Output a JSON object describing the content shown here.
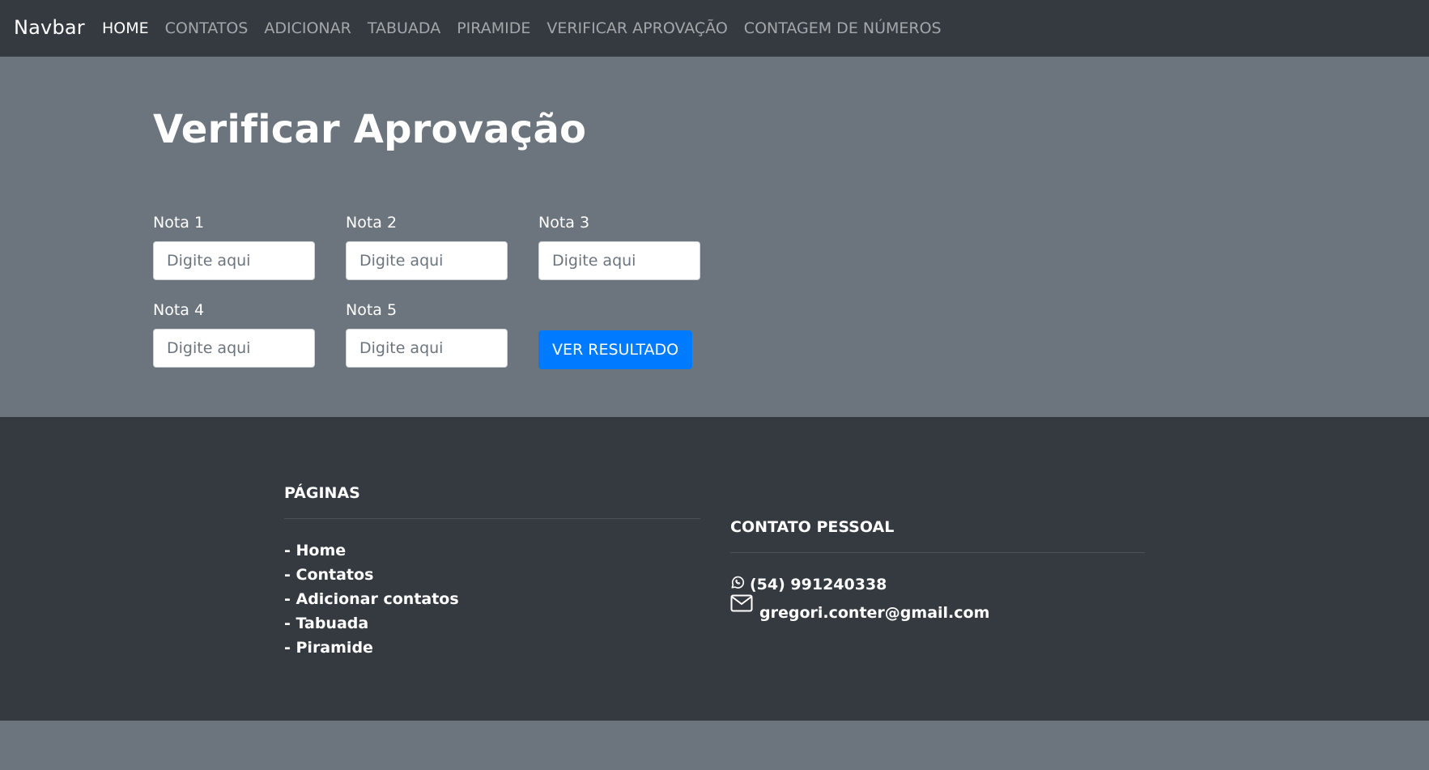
{
  "navbar": {
    "brand": "Navbar",
    "links": [
      {
        "label": "HOME",
        "active": true
      },
      {
        "label": "CONTATOS"
      },
      {
        "label": "ADICIONAR"
      },
      {
        "label": "TABUADA"
      },
      {
        "label": "PIRAMIDE"
      },
      {
        "label": "VERIFICAR APROVAÇÃO"
      },
      {
        "label": "CONTAGEM DE NÚMEROS"
      }
    ]
  },
  "main": {
    "title": "Verificar Aprovação",
    "fields": [
      {
        "label": "Nota 1",
        "placeholder": "Digite aqui",
        "value": ""
      },
      {
        "label": "Nota 2",
        "placeholder": "Digite aqui",
        "value": ""
      },
      {
        "label": "Nota 3",
        "placeholder": "Digite aqui",
        "value": ""
      },
      {
        "label": "Nota 4",
        "placeholder": "Digite aqui",
        "value": ""
      },
      {
        "label": "Nota 5",
        "placeholder": "Digite aqui",
        "value": ""
      }
    ],
    "result_button": "VER RESULTADO"
  },
  "footer": {
    "pages": {
      "heading": "PÁGINAS",
      "links": [
        "- Home",
        "- Contatos",
        "- Adicionar contatos",
        "- Tabuada",
        "- Piramide"
      ]
    },
    "contact": {
      "heading": "CONTATO PESSOAL",
      "phone": "(54) 991240338",
      "phone_icon": "whatsapp-icon",
      "email": "gregori.conter@gmail.com",
      "email_icon": "envelope-icon"
    }
  },
  "colors": {
    "navbar_bg": "#343a40",
    "main_bg": "#6c757d",
    "primary": "#007bff"
  }
}
